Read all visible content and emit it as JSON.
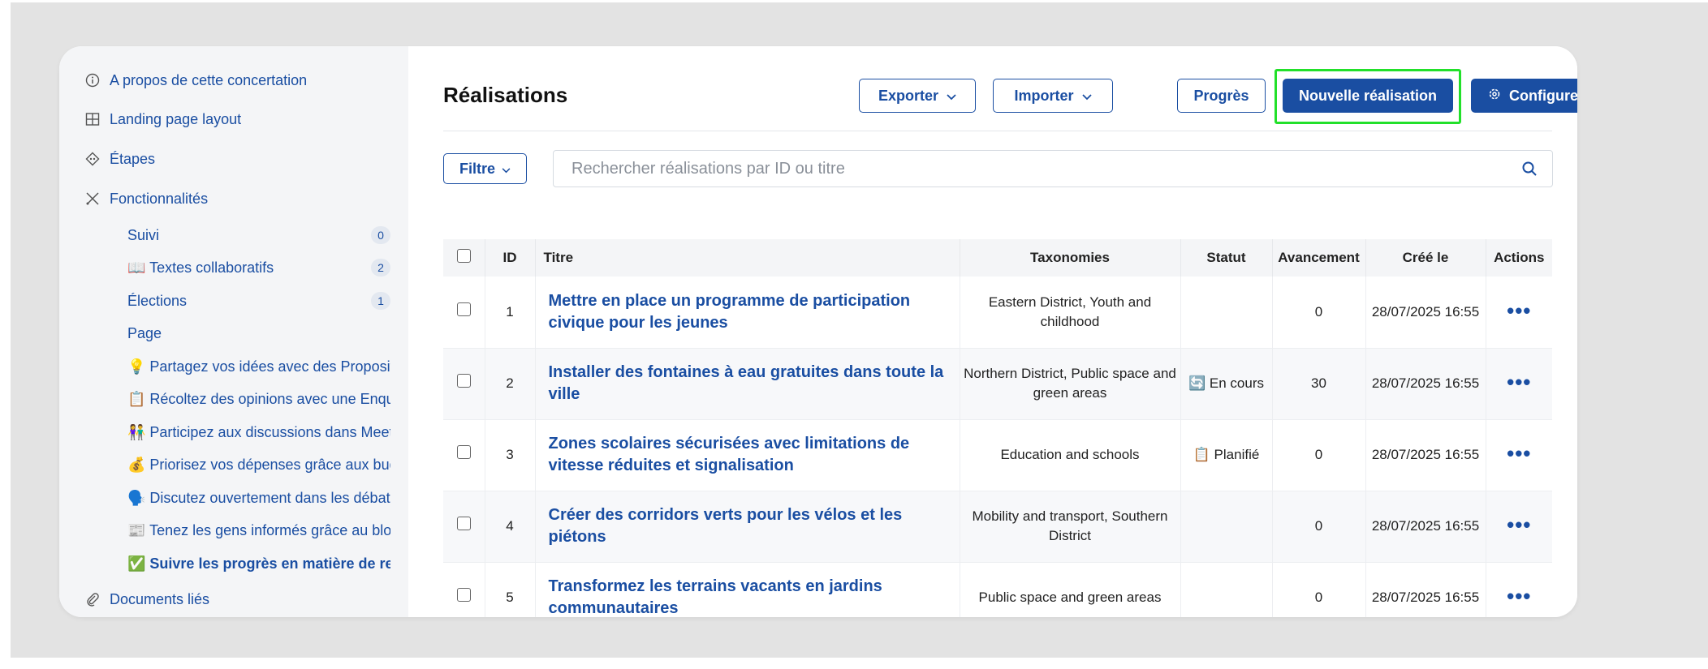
{
  "sidebar": {
    "items": [
      {
        "label": "A propos de cette concertation",
        "icon": "info-icon"
      },
      {
        "label": "Landing page layout",
        "icon": "layout-icon"
      },
      {
        "label": "Étapes",
        "icon": "steps-icon"
      },
      {
        "label": "Fonctionnalités",
        "icon": "tools-icon"
      }
    ],
    "features": [
      {
        "label": "Suivi",
        "badge": "0"
      },
      {
        "label": "📖 Textes collaboratifs",
        "badge": "2"
      },
      {
        "label": "Élections",
        "badge": "1"
      },
      {
        "label": "Page",
        "badge": ""
      },
      {
        "label": "💡 Partagez vos idées avec des Propositic",
        "badge": ""
      },
      {
        "label": "📋 Récoltez des opinions avec une Enquê",
        "badge": ""
      },
      {
        "label": "👫 Participez aux discussions dans Meetir",
        "badge": ""
      },
      {
        "label": "💰 Priorisez vos dépenses grâce aux budg",
        "badge": ""
      },
      {
        "label": "🗣️ Discutez ouvertement dans les débats",
        "badge": ""
      },
      {
        "label": "📰 Tenez les gens informés grâce au blog",
        "badge": ""
      },
      {
        "label": "✅ Suivre les progrès en matière de resp",
        "badge": ""
      }
    ],
    "documents": "Documents liés"
  },
  "header": {
    "title": "Réalisations",
    "export": "Exporter",
    "import": "Importer",
    "progress": "Progrès",
    "new": "Nouvelle réalisation",
    "configure": "Configurer"
  },
  "toolbar": {
    "filter": "Filtre",
    "search_placeholder": "Rechercher réalisations par ID ou titre"
  },
  "table": {
    "columns": {
      "id": "ID",
      "title": "Titre",
      "taxonomies": "Taxonomies",
      "status": "Statut",
      "progress": "Avancement",
      "created": "Créé le",
      "actions": "Actions"
    },
    "rows": [
      {
        "id": "1",
        "title": "Mettre en place un programme de participation civique pour les jeunes",
        "taxonomies": "Eastern District, Youth and childhood",
        "status": "",
        "progress": "0",
        "created": "28/07/2025 16:55"
      },
      {
        "id": "2",
        "title": "Installer des fontaines à eau gratuites dans toute la ville",
        "taxonomies": "Northern District, Public space and green areas",
        "status": "🔄 En cours",
        "progress": "30",
        "created": "28/07/2025 16:55"
      },
      {
        "id": "3",
        "title": "Zones scolaires sécurisées avec limitations de vitesse réduites et signalisation",
        "taxonomies": "Education and schools",
        "status": "📋 Planifié",
        "progress": "0",
        "created": "28/07/2025 16:55"
      },
      {
        "id": "4",
        "title": "Créer des corridors verts pour les vélos et les piétons",
        "taxonomies": "Mobility and transport, Southern District",
        "status": "",
        "progress": "0",
        "created": "28/07/2025 16:55"
      },
      {
        "id": "5",
        "title": "Transformez les terrains vacants en jardins communautaires",
        "taxonomies": "Public space and green areas",
        "status": "",
        "progress": "0",
        "created": "28/07/2025 16:55"
      }
    ]
  },
  "colors": {
    "primary": "#1a4ea2",
    "highlight": "#22e02a",
    "sidebar_bg": "#f4f5f7"
  }
}
